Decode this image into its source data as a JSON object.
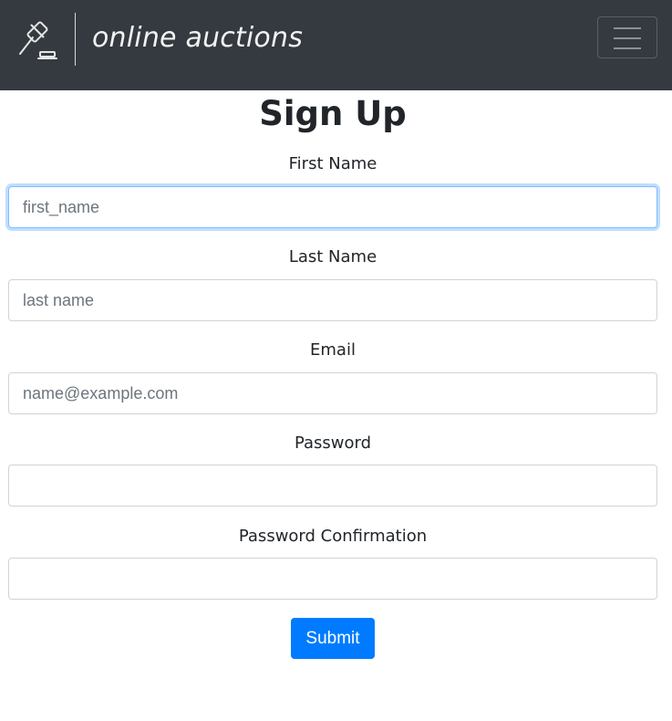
{
  "navbar": {
    "brand_text": "online auctions",
    "brand_icon": "gavel-icon",
    "toggler_icon": "hamburger-menu-icon",
    "background": "#343a40"
  },
  "form": {
    "title": "Sign Up",
    "fields": [
      {
        "label": "First Name",
        "placeholder": "first_name",
        "value": "",
        "focused": true
      },
      {
        "label": "Last Name",
        "placeholder": "last name",
        "value": ""
      },
      {
        "label": "Email",
        "placeholder": "name@example.com",
        "value": ""
      },
      {
        "label": "Password",
        "placeholder": "",
        "value": ""
      },
      {
        "label": "Password Confirmation",
        "placeholder": "",
        "value": ""
      }
    ],
    "submit_label": "Submit",
    "accent_color": "#007bff"
  }
}
